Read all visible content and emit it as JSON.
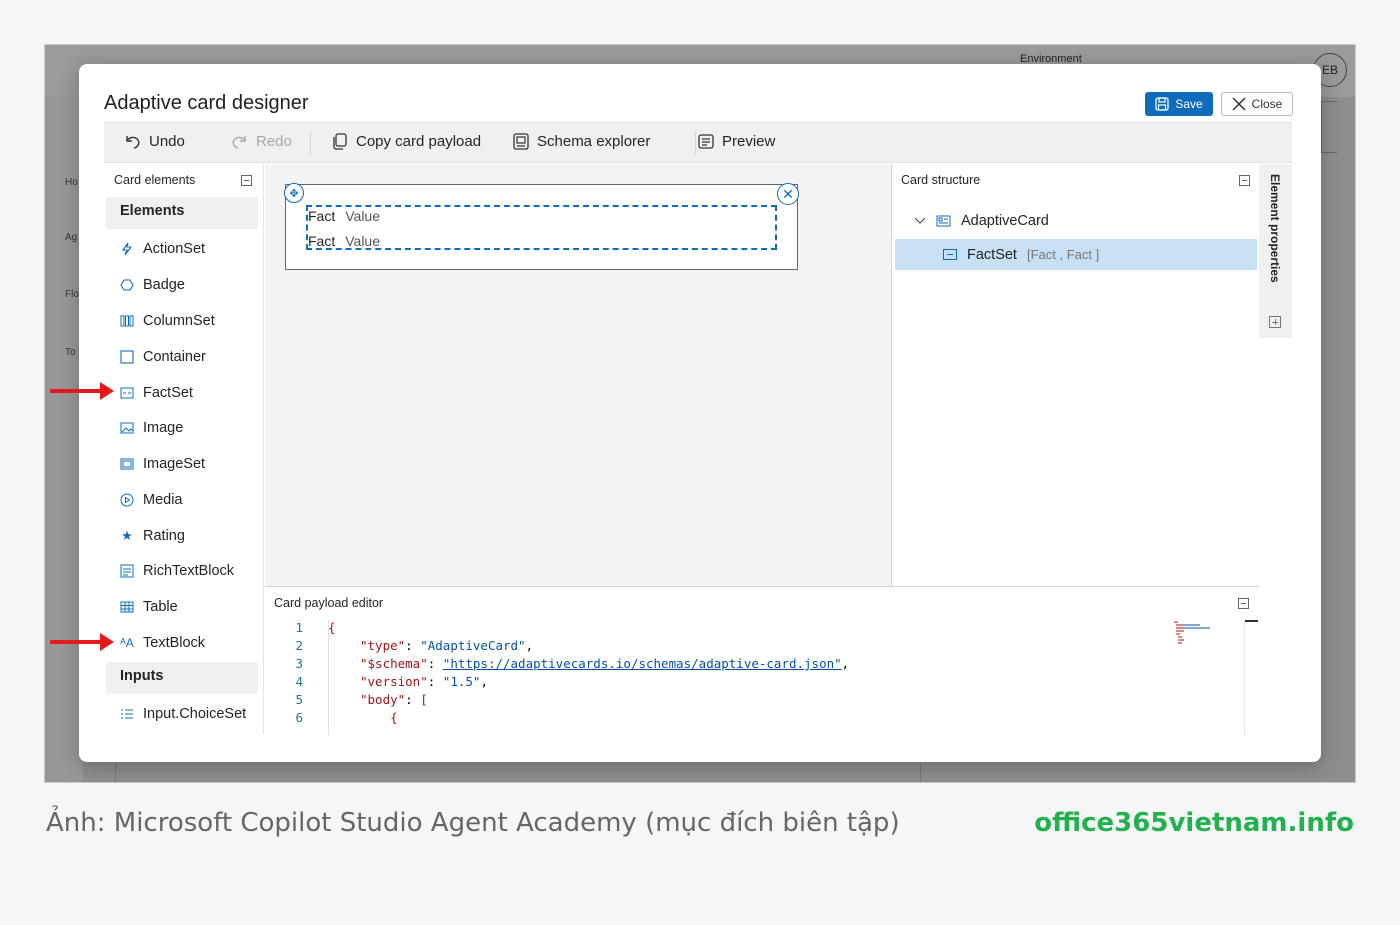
{
  "background_app": {
    "environment_label": "Environment",
    "avatar_initials": "EB",
    "rail_labels": [
      "Ho",
      "Ag",
      "Flo",
      "To"
    ]
  },
  "modal": {
    "title": "Adaptive card designer",
    "save_label": "Save",
    "close_label": "Close"
  },
  "toolbar": {
    "undo": "Undo",
    "redo": "Redo",
    "copy_payload": "Copy card payload",
    "schema_explorer": "Schema explorer",
    "preview": "Preview"
  },
  "card_elements": {
    "header": "Card elements",
    "elements_category": "Elements",
    "items": [
      {
        "label": "ActionSet",
        "icon": "lightning-icon"
      },
      {
        "label": "Badge",
        "icon": "badge-icon"
      },
      {
        "label": "ColumnSet",
        "icon": "columns-icon"
      },
      {
        "label": "Container",
        "icon": "square-icon"
      },
      {
        "label": "FactSet",
        "icon": "factset-icon"
      },
      {
        "label": "Image",
        "icon": "image-icon"
      },
      {
        "label": "ImageSet",
        "icon": "images-icon"
      },
      {
        "label": "Media",
        "icon": "play-icon"
      },
      {
        "label": "Rating",
        "icon": "star-icon"
      },
      {
        "label": "RichTextBlock",
        "icon": "richtext-icon"
      },
      {
        "label": "Table",
        "icon": "table-icon"
      },
      {
        "label": "TextBlock",
        "icon": "text-icon"
      }
    ],
    "inputs_category": "Inputs",
    "inputs": [
      {
        "label": "Input.ChoiceSet",
        "icon": "list-icon"
      }
    ]
  },
  "canvas": {
    "facts": [
      {
        "title": "Fact",
        "value": "Value"
      },
      {
        "title": "Fact",
        "value": "Value"
      }
    ]
  },
  "card_structure": {
    "header": "Card structure",
    "root": "AdaptiveCard",
    "child": "FactSet",
    "child_summary": "[Fact , Fact ]"
  },
  "element_properties": {
    "label": "Element properties"
  },
  "payload_editor": {
    "header": "Card payload editor",
    "lines": [
      {
        "n": "1",
        "text": "{"
      },
      {
        "n": "2",
        "key": "\"type\"",
        "sep": ": ",
        "value": "\"AdaptiveCard\"",
        "tail": ","
      },
      {
        "n": "3",
        "key": "\"$schema\"",
        "sep": ": ",
        "value": "\"https://adaptivecards.io/schemas/adaptive-card.json\"",
        "tail": ","
      },
      {
        "n": "4",
        "key": "\"version\"",
        "sep": ": ",
        "value": "\"1.5\"",
        "tail": ","
      },
      {
        "n": "5",
        "key": "\"body\"",
        "sep": ": ",
        "value": "[",
        "tail": ""
      },
      {
        "n": "6",
        "text": "    {"
      }
    ]
  },
  "caption": {
    "text": "Ảnh: Microsoft Copilot Studio Agent Academy (mục đích biên tập)",
    "brand": "office365vietnam.info"
  },
  "colors": {
    "accent": "#0f6cbd",
    "selection": "#c7e0f4",
    "arrow": "#e3191d",
    "brand": "#22b14c"
  }
}
